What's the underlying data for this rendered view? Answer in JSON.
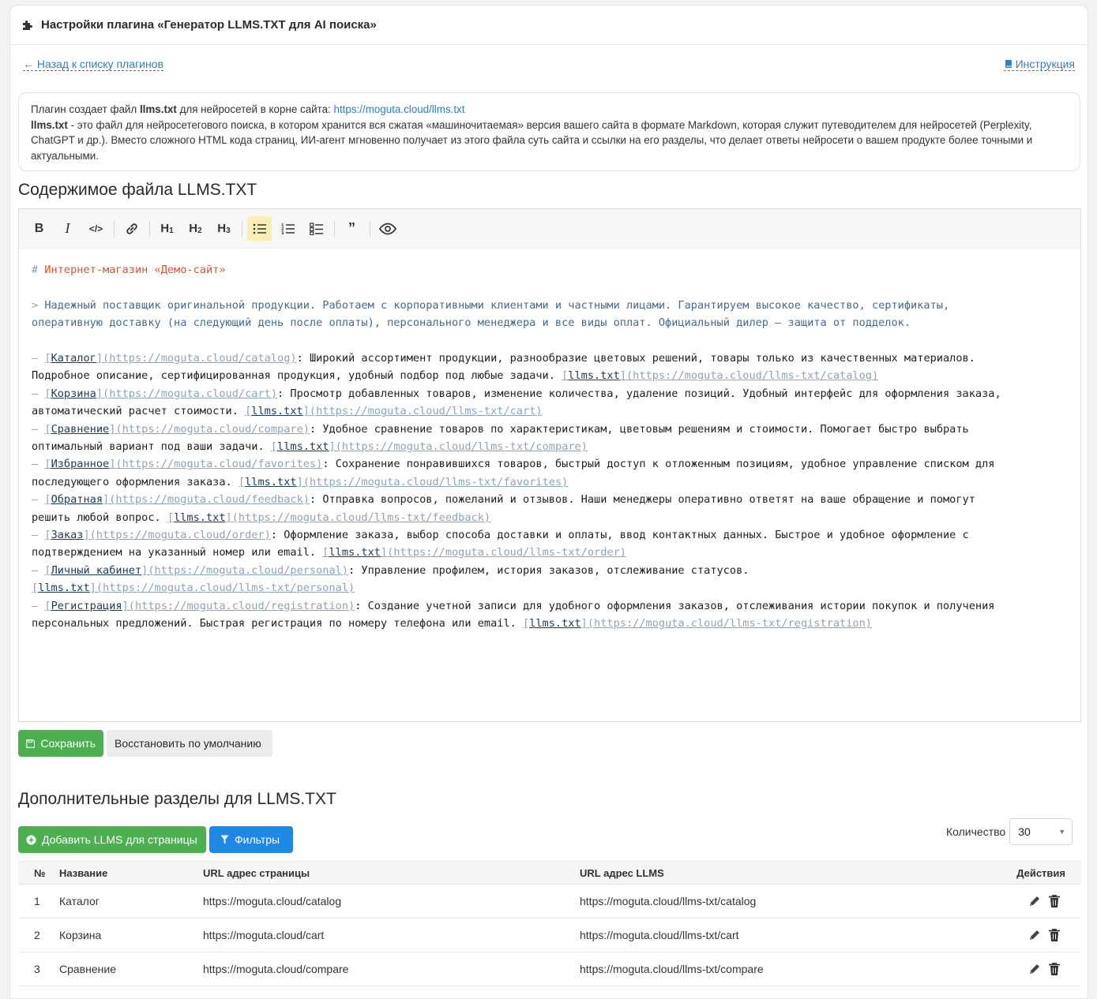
{
  "header": {
    "title": "Настройки плагина «Генератор LLMS.TXT для AI поиска»"
  },
  "nav": {
    "back_label": "← Назад к списку плагинов",
    "guide_label": "Инструкция"
  },
  "info": {
    "line1_prefix": "Плагин создает файл ",
    "line1_bold": "llms.txt",
    "line1_mid": " для нейросетей в корне сайта: ",
    "line1_link": "https://moguta.cloud/llms.txt",
    "line2_bold": "llms.txt",
    "line2_text": " - это файл для нейросетегового поиска, в котором хранится вся сжатая «машиночитаемая» версия вашего сайта в формате Markdown, которая служит путеводителем для нейросетей (Perplexity, ChatGPT и др.). Вместо сложного HTML кода страниц, ИИ-агент мгновенно получает из этого файла суть сайта и ссылки на его разделы, что делает ответы нейросети о вашем продукте более точными и актуальными."
  },
  "editor": {
    "title": "Содержимое файла LLMS.TXT",
    "toolbar": [
      "B",
      "I",
      "code",
      "link",
      "H1",
      "H2",
      "H3",
      "ul",
      "ol",
      "task",
      "quote",
      "preview"
    ],
    "heading_mark": "#",
    "heading": "Интернет-магазин «Демо-сайт»",
    "quote_mark": ">",
    "quote_line1": "Надежный поставщик оригинальной продукции. Работаем с корпоративными клиентами и частными лицами. Гарантируем высокое качество, сертификаты,",
    "quote_line2": "оперативную доставку (на следующий день после оплаты), персонального менеджера и все виды оплат. Официальный дилер — защита от подделок.",
    "items": [
      {
        "l1_title": "Каталог",
        "l1_url": "https://moguta.cloud/catalog",
        "l1_desc": ": Широкий ассортимент продукции, разнообразие цветовых решений, товары только из качественных материалов.",
        "l2_desc": "Подробное описание, сертифицированная продукция, удобный подбор под любые задачи. ",
        "llms_text": "llms.txt",
        "llms_url": "https://moguta.cloud/llms-txt/catalog"
      },
      {
        "l1_title": "Корзина",
        "l1_url": "https://moguta.cloud/cart",
        "l1_desc": ": Просмотр добавленных товаров, изменение количества, удаление позиций. Удобный интерфейс для оформления заказа,",
        "l2_desc": "автоматический расчет стоимости. ",
        "llms_text": "llms.txt",
        "llms_url": "https://moguta.cloud/llms-txt/cart"
      },
      {
        "l1_title": "Сравнение",
        "l1_url": "https://moguta.cloud/compare",
        "l1_desc": ": Удобное сравнение товаров по характеристикам, цветовым решениям и стоимости. Помогает быстро выбрать",
        "l2_desc": "оптимальный вариант под ваши задачи. ",
        "llms_text": "llms.txt",
        "llms_url": "https://moguta.cloud/llms-txt/compare"
      },
      {
        "l1_title": "Избранное",
        "l1_url": "https://moguta.cloud/favorites",
        "l1_desc": ": Сохранение понравившихся товаров, быстрый доступ к отложенным позициям, удобное управление списком для",
        "l2_desc": "последующего оформления заказа. ",
        "llms_text": "llms.txt",
        "llms_url": "https://moguta.cloud/llms-txt/favorites"
      },
      {
        "l1_title": "Обратная",
        "l1_url": "https://moguta.cloud/feedback",
        "l1_desc": ": Отправка вопросов, пожеланий и отзывов. Наши менеджеры оперативно ответят на ваше обращение и помогут",
        "l2_desc": "решить любой вопрос. ",
        "llms_text": "llms.txt",
        "llms_url": "https://moguta.cloud/llms-txt/feedback"
      },
      {
        "l1_title": "Заказ",
        "l1_url": "https://moguta.cloud/order",
        "l1_desc": ": Оформление заказа, выбор способа доставки и оплаты, ввод контактных данных. Быстрое и удобное оформление с",
        "l2_desc": "подтверждением на указанный номер или email. ",
        "llms_text": "llms.txt",
        "llms_url": "https://moguta.cloud/llms-txt/order"
      },
      {
        "l1_title": "Личный кабинет",
        "l1_url": "https://moguta.cloud/personal",
        "l1_desc": ": Управление профилем, история заказов, отслеживание статусов.",
        "l2_desc": "",
        "llms_text": "llms.txt",
        "llms_url": "https://moguta.cloud/llms-txt/personal"
      },
      {
        "l1_title": "Регистрация",
        "l1_url": "https://moguta.cloud/registration",
        "l1_desc": ": Создание учетной записи для удобного оформления заказов, отслеживания истории покупок и получения",
        "l2_desc": "персональных предложений. Быстрая регистрация по номеру телефона или email. ",
        "llms_text": "llms.txt",
        "llms_url": "https://moguta.cloud/llms-txt/registration"
      }
    ]
  },
  "actions": {
    "save_label": "Сохранить",
    "reset_label": "Восстановить по умолчанию"
  },
  "extra": {
    "title": "Дополнительные разделы для LLMS.TXT",
    "add_label": "Добавить LLMS для страницы",
    "filter_label": "Фильтры",
    "count_label": "Количество",
    "count_value": "30"
  },
  "table": {
    "headers": {
      "num": "№",
      "name": "Название",
      "url": "URL адрес страницы",
      "llms": "URL адрес LLMS",
      "actions": "Действия"
    },
    "rows": [
      {
        "num": "1",
        "name": "Каталог",
        "url": "https://moguta.cloud/catalog",
        "llms": "https://moguta.cloud/llms-txt/catalog"
      },
      {
        "num": "2",
        "name": "Корзина",
        "url": "https://moguta.cloud/cart",
        "llms": "https://moguta.cloud/llms-txt/cart"
      },
      {
        "num": "3",
        "name": "Сравнение",
        "url": "https://moguta.cloud/compare",
        "llms": "https://moguta.cloud/llms-txt/compare"
      }
    ]
  },
  "colors": {
    "accent_green": "#4caf50",
    "accent_blue": "#1e88e5",
    "link": "#2f7fc1",
    "heading_red": "#e0512d"
  }
}
